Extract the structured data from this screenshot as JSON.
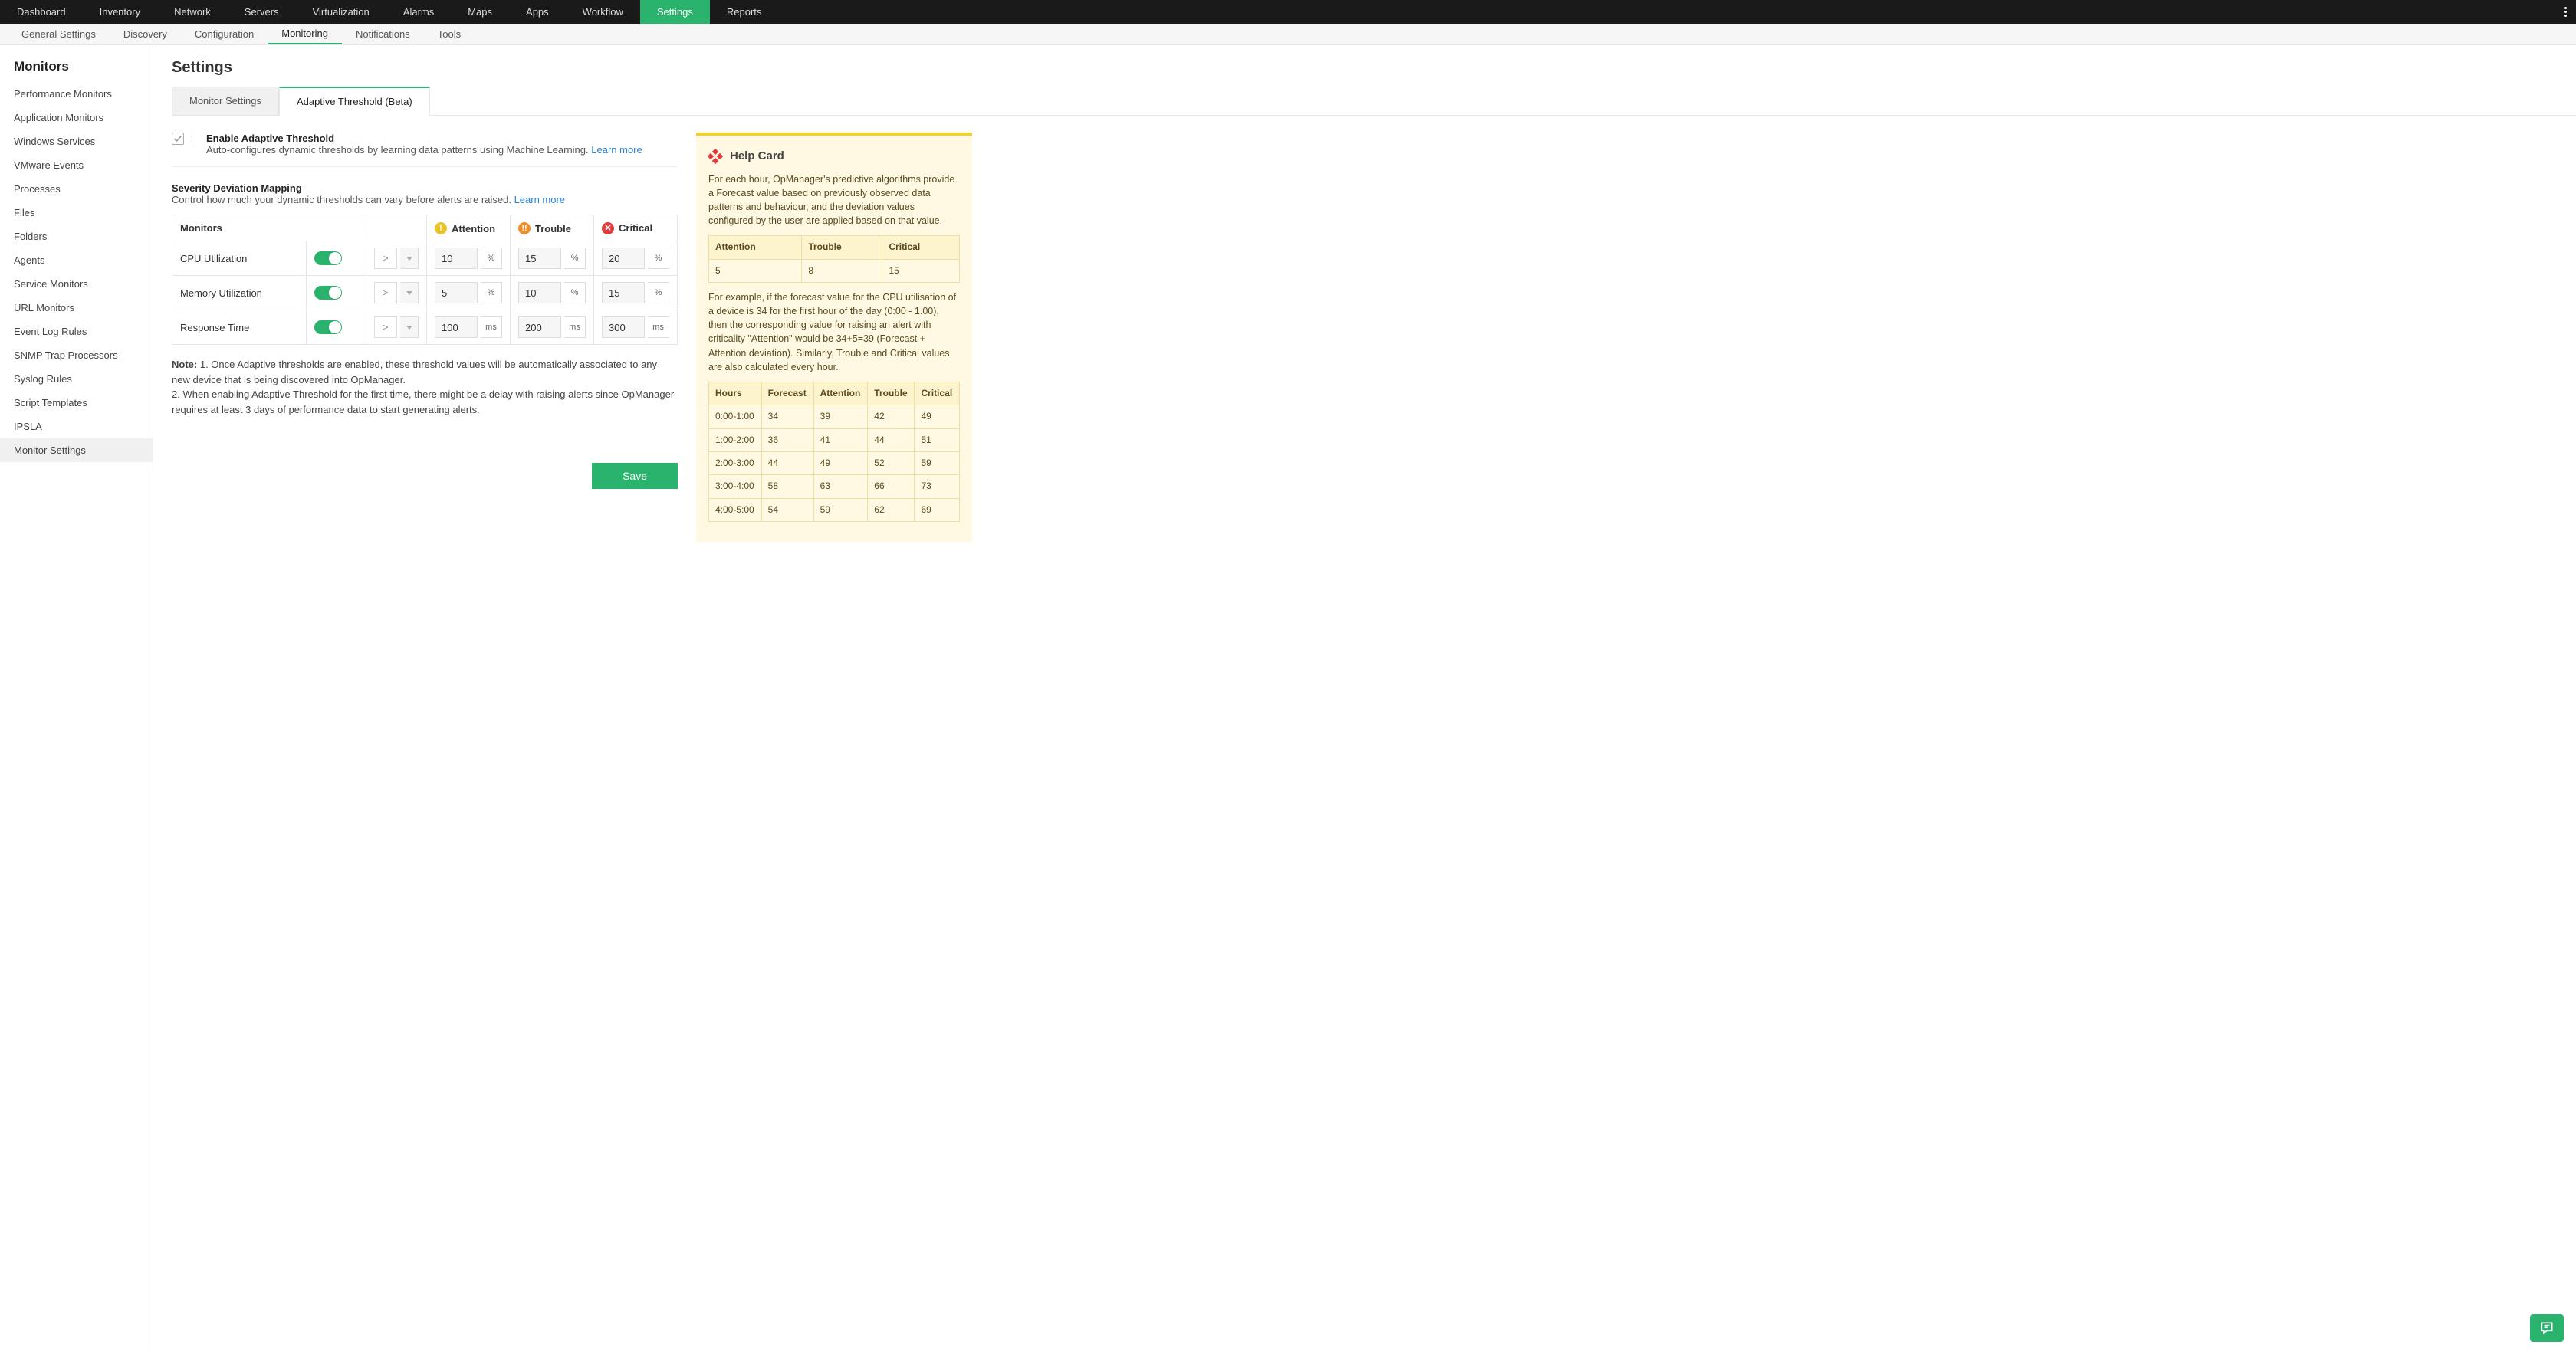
{
  "topnav": {
    "items": [
      "Dashboard",
      "Inventory",
      "Network",
      "Servers",
      "Virtualization",
      "Alarms",
      "Maps",
      "Apps",
      "Workflow",
      "Settings",
      "Reports"
    ],
    "active": "Settings"
  },
  "subnav": {
    "items": [
      "General Settings",
      "Discovery",
      "Configuration",
      "Monitoring",
      "Notifications",
      "Tools"
    ],
    "active": "Monitoring"
  },
  "sidebar": {
    "title": "Monitors",
    "items": [
      "Performance Monitors",
      "Application Monitors",
      "Windows Services",
      "VMware Events",
      "Processes",
      "Files",
      "Folders",
      "Agents",
      "Service Monitors",
      "URL Monitors",
      "Event Log Rules",
      "SNMP Trap Processors",
      "Syslog Rules",
      "Script Templates",
      "IPSLA",
      "Monitor Settings"
    ],
    "active": "Monitor Settings"
  },
  "page": {
    "title": "Settings"
  },
  "tabs": {
    "items": [
      "Monitor Settings",
      "Adaptive Threshold (Beta)"
    ],
    "active": "Adaptive Threshold (Beta)"
  },
  "enable": {
    "title": "Enable Adaptive Threshold",
    "desc": "Auto-configures dynamic thresholds by learning data patterns using Machine Learning.",
    "learn_more": "Learn more",
    "checked": true
  },
  "severity": {
    "title": "Severity Deviation Mapping",
    "sub": "Control how much your dynamic thresholds can vary before alerts are raised.",
    "learn_more": "Learn more",
    "headers": {
      "monitors": "Monitors",
      "attention": "Attention",
      "trouble": "Trouble",
      "critical": "Critical"
    },
    "rows": [
      {
        "name": "CPU Utilization",
        "enabled": true,
        "op": ">",
        "attention": "10",
        "trouble": "15",
        "critical": "20",
        "unit": "%"
      },
      {
        "name": "Memory Utilization",
        "enabled": true,
        "op": ">",
        "attention": "5",
        "trouble": "10",
        "critical": "15",
        "unit": "%"
      },
      {
        "name": "Response Time",
        "enabled": true,
        "op": ">",
        "attention": "100",
        "trouble": "200",
        "critical": "300",
        "unit": "ms"
      }
    ]
  },
  "note_label": "Note:",
  "note1": "1. Once Adaptive thresholds are enabled, these threshold values will be automatically associated to any new device that is being discovered into OpManager.",
  "note2": "2. When enabling Adaptive Threshold for the first time, there might be a delay with raising alerts since OpManager requires at least 3 days of performance data to start generating alerts.",
  "save": "Save",
  "help": {
    "title": "Help Card",
    "p1": "For each hour, OpManager's predictive algorithms provide a Forecast value based on previously observed data patterns and behaviour, and the deviation values configured by the user are applied based on that value.",
    "small_table": {
      "headers": [
        "Attention",
        "Trouble",
        "Critical"
      ],
      "row": [
        "5",
        "8",
        "15"
      ]
    },
    "p2": "For example, if the forecast value for the CPU utilisation of a device is 34 for the first hour of the day (0:00 - 1.00), then the corresponding value for raising an alert with criticality \"Attention\" would be 34+5=39 (Forecast + Attention deviation). Similarly, Trouble and Critical values are also calculated every hour.",
    "big_table": {
      "headers": [
        "Hours",
        "Forecast",
        "Attention",
        "Trouble",
        "Critical"
      ],
      "rows": [
        [
          "0:00-1:00",
          "34",
          "39",
          "42",
          "49"
        ],
        [
          "1:00-2:00",
          "36",
          "41",
          "44",
          "51"
        ],
        [
          "2:00-3:00",
          "44",
          "49",
          "52",
          "59"
        ],
        [
          "3:00-4:00",
          "58",
          "63",
          "66",
          "73"
        ],
        [
          "4:00-5:00",
          "54",
          "59",
          "62",
          "69"
        ]
      ]
    }
  }
}
